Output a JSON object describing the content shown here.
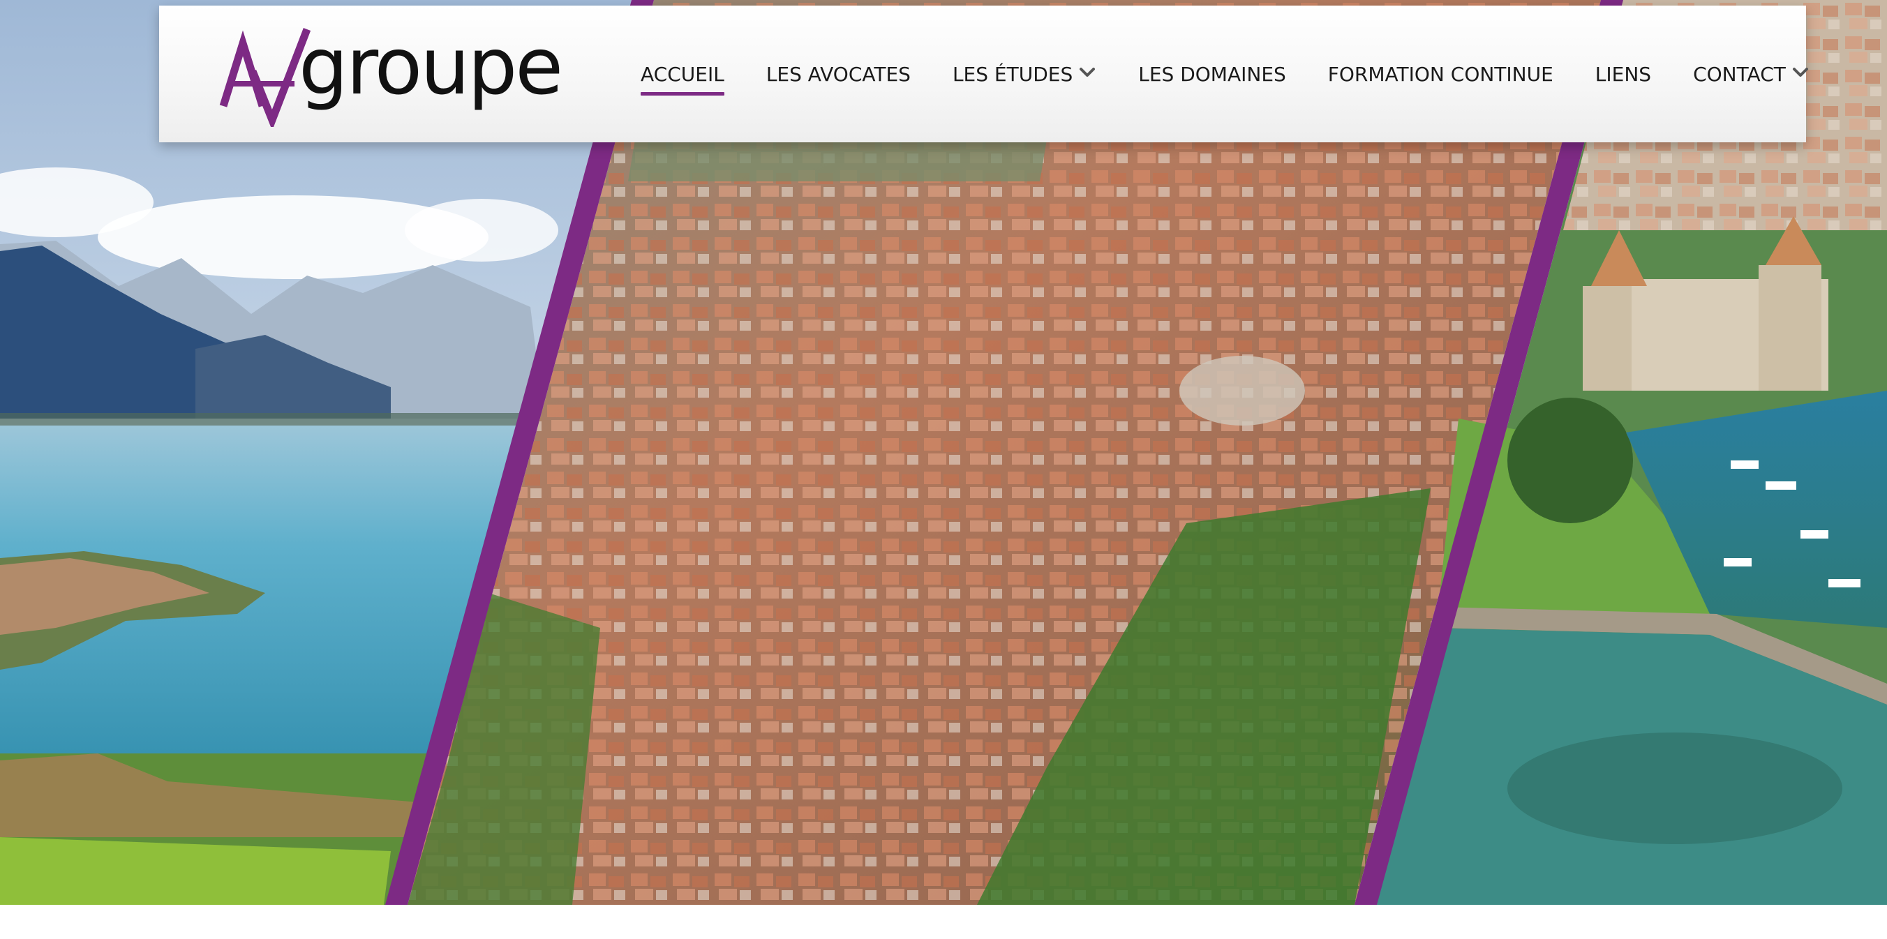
{
  "brand": {
    "wordmark": "groupe",
    "monogram_icon": "av-monogram-logo",
    "accent_color": "#7d2a84"
  },
  "nav": {
    "items": [
      {
        "label": "ACCUEIL",
        "active": true,
        "has_dropdown": false
      },
      {
        "label": "LES AVOCATES",
        "active": false,
        "has_dropdown": false
      },
      {
        "label": "LES ÉTUDES",
        "active": false,
        "has_dropdown": true
      },
      {
        "label": "LES DOMAINES",
        "active": false,
        "has_dropdown": false
      },
      {
        "label": "FORMATION CONTINUE",
        "active": false,
        "has_dropdown": false
      },
      {
        "label": "LIENS",
        "active": false,
        "has_dropdown": false
      },
      {
        "label": "CONTACT",
        "active": false,
        "has_dropdown": true
      }
    ],
    "dropdown_icon": "chevron-down-icon"
  },
  "hero": {
    "panels": [
      "lake-and-mountains-photo",
      "town-aerial-photo",
      "castle-harbor-photo"
    ],
    "divider_color": "#7d2a84"
  }
}
